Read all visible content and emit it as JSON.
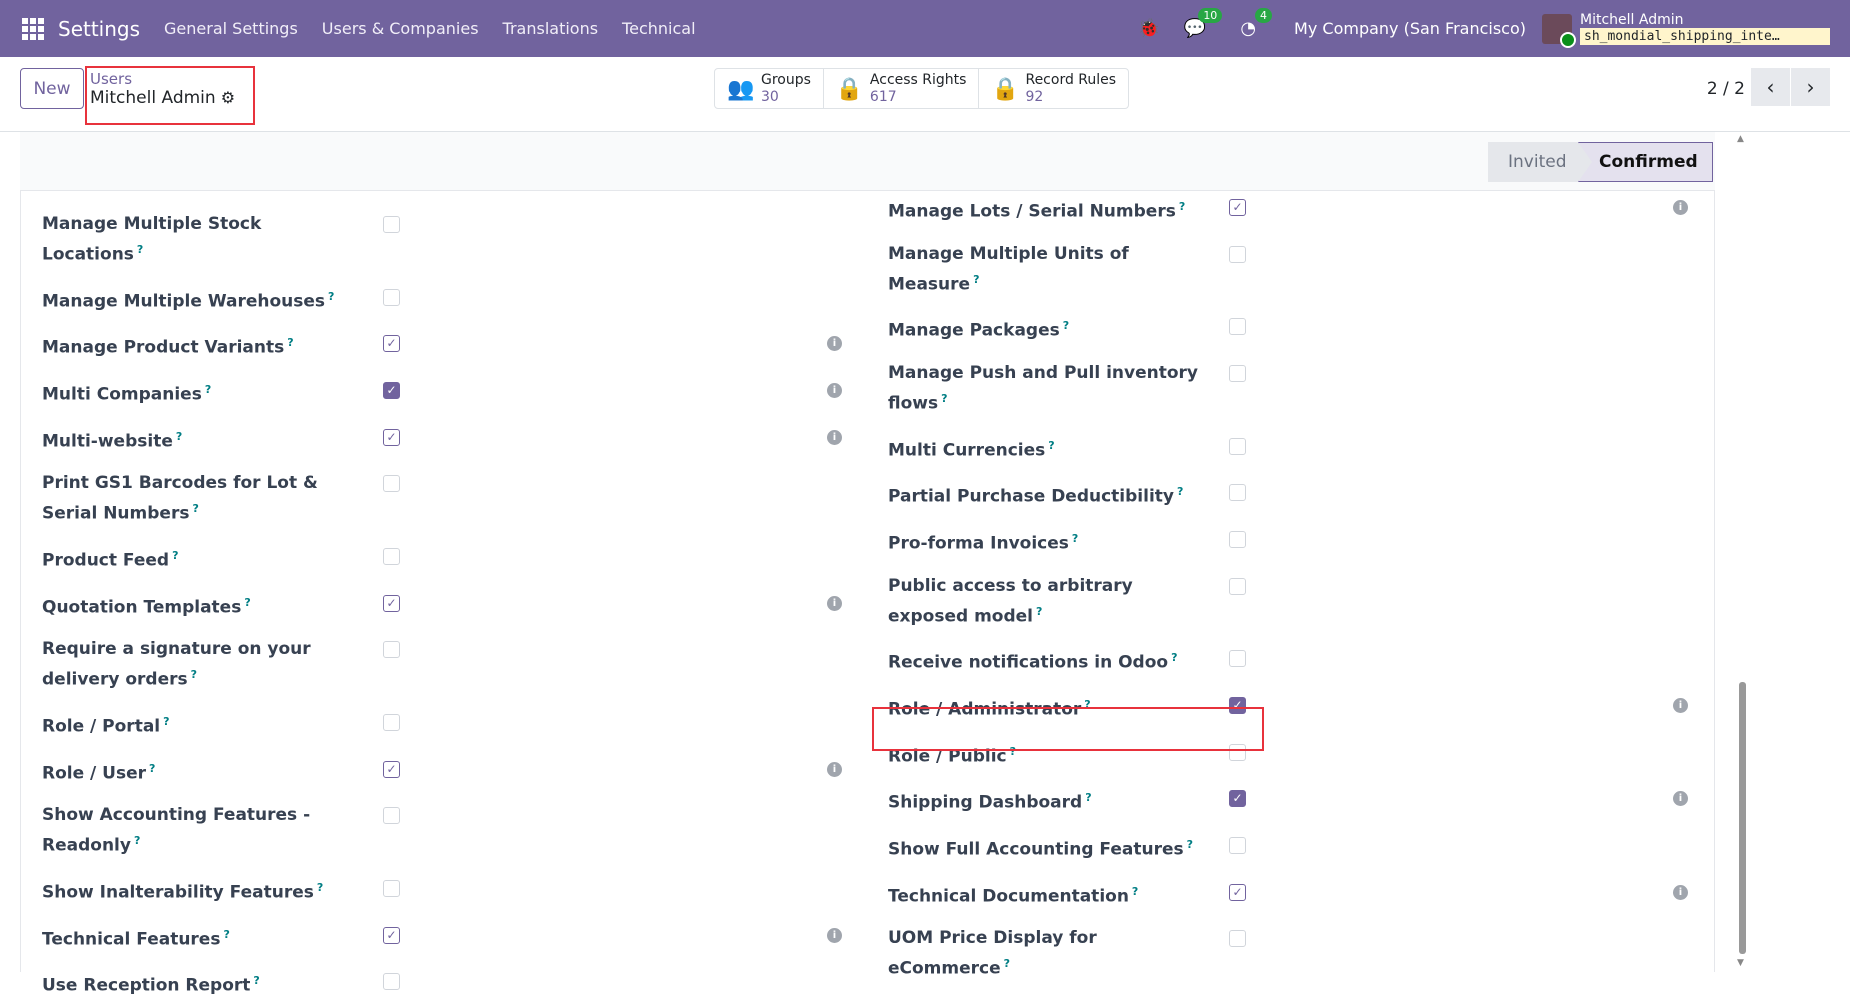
{
  "nav": {
    "app": "Settings",
    "menus": [
      "General Settings",
      "Users & Companies",
      "Translations",
      "Technical"
    ],
    "messages_count": "10",
    "activities_count": "4",
    "company": "My Company (San Francisco)",
    "user": "Mitchell Admin",
    "database": "sh_mondial_shipping_inte…"
  },
  "control": {
    "new_label": "New",
    "breadcrumb_parent": "Users",
    "record_name": "Mitchell Admin",
    "stats": [
      {
        "label": "Groups",
        "value": "30"
      },
      {
        "label": "Access Rights",
        "value": "617"
      },
      {
        "label": "Record Rules",
        "value": "92"
      }
    ],
    "pager": "2 / 2"
  },
  "statusbar": {
    "stages": [
      "Invited",
      "Confirmed"
    ],
    "current": "Confirmed"
  },
  "left": [
    {
      "label": "Manage Multiple Stock Locations",
      "state": "off"
    },
    {
      "label": "Manage Multiple Warehouses",
      "state": "off"
    },
    {
      "label": "Manage Product Variants",
      "state": "on",
      "info": true
    },
    {
      "label": "Multi Companies",
      "state": "fill",
      "info": true
    },
    {
      "label": "Multi-website",
      "state": "on",
      "info": true
    },
    {
      "label": "Print GS1 Barcodes for Lot & Serial Numbers",
      "state": "off"
    },
    {
      "label": "Product Feed",
      "state": "off"
    },
    {
      "label": "Quotation Templates",
      "state": "on",
      "info": true
    },
    {
      "label": "Require a signature on your delivery orders",
      "state": "off"
    },
    {
      "label": "Role / Portal",
      "state": "off"
    },
    {
      "label": "Role / User",
      "state": "on",
      "info": true
    },
    {
      "label": "Show Accounting Features - Readonly",
      "state": "off"
    },
    {
      "label": "Show Inalterability Features",
      "state": "off"
    },
    {
      "label": "Technical Features",
      "state": "on",
      "info": true
    },
    {
      "label": "Use Reception Report",
      "state": "off"
    }
  ],
  "right": [
    {
      "label": "Manage Lots / Serial Numbers",
      "state": "on",
      "info": true
    },
    {
      "label": "Manage Multiple Units of Measure",
      "state": "off"
    },
    {
      "label": "Manage Packages",
      "state": "off"
    },
    {
      "label": "Manage Push and Pull inventory flows",
      "state": "off"
    },
    {
      "label": "Multi Currencies",
      "state": "off"
    },
    {
      "label": "Partial Purchase Deductibility",
      "state": "off"
    },
    {
      "label": "Pro-forma Invoices",
      "state": "off"
    },
    {
      "label": "Public access to arbitrary exposed model",
      "state": "off"
    },
    {
      "label": "Receive notifications in Odoo",
      "state": "off"
    },
    {
      "label": "Role / Administrator",
      "state": "fill",
      "info": true
    },
    {
      "label": "Role / Public",
      "state": "off"
    },
    {
      "label": "Shipping Dashboard",
      "state": "fill",
      "info": true
    },
    {
      "label": "Show Full Accounting Features",
      "state": "off"
    },
    {
      "label": "Technical Documentation",
      "state": "on",
      "info": true
    },
    {
      "label": "UOM Price Display for eCommerce",
      "state": "off"
    }
  ]
}
